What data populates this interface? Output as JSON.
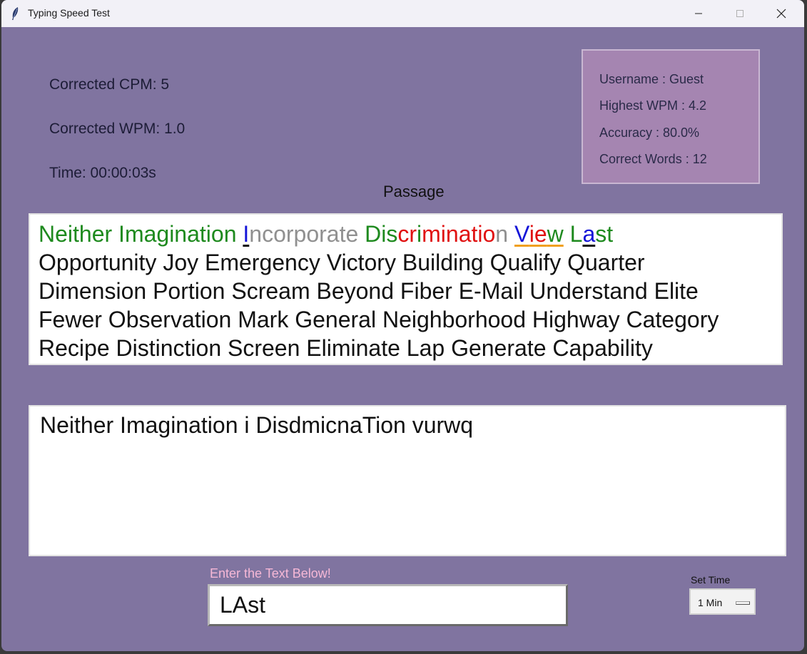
{
  "window": {
    "title": "Typing Speed Test",
    "minimize_icon": "minimize-icon",
    "maximize_icon": "maximize-icon",
    "close_icon": "close-icon"
  },
  "stats": {
    "cpm": "Corrected CPM: 5",
    "wpm": "Corrected WPM: 1.0",
    "time": "Time: 00:00:03s"
  },
  "info": {
    "username": "Username : Guest",
    "highest_wpm": "Highest WPM : 4.2",
    "accuracy": "Accuracy : 80.0%",
    "correct_words": "Correct Words : 12"
  },
  "passage": {
    "label": "Passage",
    "line1": {
      "w1": "Neither",
      "w2": "Imagination",
      "w3_first": "I",
      "w3_rest": "ncorporate",
      "w4_a": "Dis",
      "w4_b": "cr",
      "w4_c": "i",
      "w4_d": "minatio",
      "w4_e": "n",
      "w5_a": "V",
      "w5_b": "ie",
      "w5_c": "w",
      "w6_a": "L",
      "w6_b": "a",
      "w6_c": "st"
    },
    "line2": "Opportunity Joy Emergency Victory Building Qualify Quarter",
    "line3": "Dimension Portion Scream Beyond Fiber E-Mail Understand Elite",
    "line4": "Fewer Observation Mark General Neighborhood Highway Category",
    "line5": "Recipe Distinction Screen Eliminate Lap Generate Capability"
  },
  "typed_text": "Neither Imagination i DisdmicnaTion vurwq",
  "entry": {
    "label": "Enter the Text Below!",
    "value": "LAst"
  },
  "set_time": {
    "label": "Set Time",
    "selected": "1 Min"
  },
  "colors": {
    "background": "#8074a0",
    "info_box": "#a585b1",
    "correct": "#1e8a1e",
    "wrong": "#e01010",
    "pending": "#909090",
    "current": "#1414d8",
    "entry_label": "#f6b8d6"
  }
}
